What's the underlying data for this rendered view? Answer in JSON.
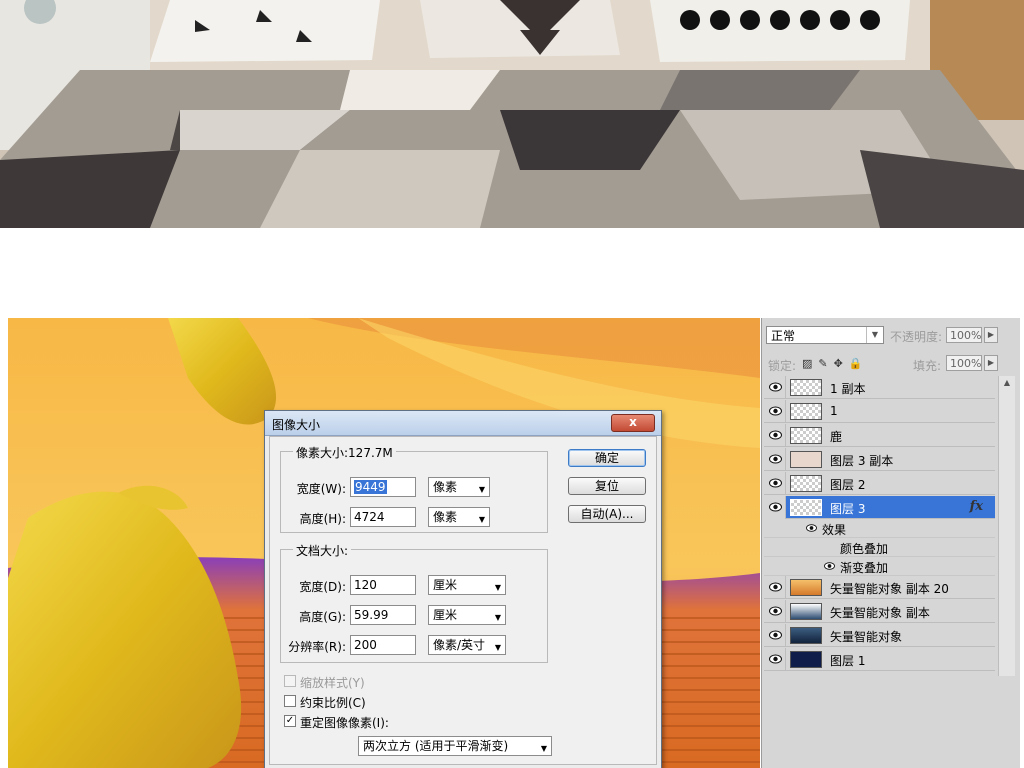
{
  "dialog": {
    "title": "图像大小",
    "close_label": "x",
    "pixel_dims": {
      "legend": "像素大小:127.7M",
      "width_label": "宽度(W):",
      "width_value": "9449",
      "width_unit": "像素",
      "height_label": "高度(H):",
      "height_value": "4724",
      "height_unit": "像素"
    },
    "doc_size": {
      "legend": "文档大小:",
      "width_label": "宽度(D):",
      "width_value": "120",
      "width_unit": "厘米",
      "height_label": "高度(G):",
      "height_value": "59.99",
      "height_unit": "厘米",
      "res_label": "分辨率(R):",
      "res_value": "200",
      "res_unit": "像素/英寸"
    },
    "buttons": {
      "ok": "确定",
      "reset": "复位",
      "auto": "自动(A)..."
    },
    "options": {
      "scale_styles": "缩放样式(Y)",
      "constrain": "约束比例(C)",
      "resample": "重定图像像素(I):",
      "resample_method": "两次立方 (适用于平滑渐变)"
    }
  },
  "layers_panel": {
    "blend_mode": "正常",
    "opacity_label": "不透明度:",
    "opacity_value": "100%",
    "lock_label": "锁定:",
    "fill_label": "填充:",
    "fill_value": "100%",
    "fx_label": "fx",
    "layers": [
      {
        "name": "1 副本"
      },
      {
        "name": "1"
      },
      {
        "name": "鹿"
      },
      {
        "name": "图层 3 副本"
      },
      {
        "name": "图层 2"
      },
      {
        "name": "图层 3",
        "selected": true
      },
      {
        "name": "矢量智能对象 副本 20"
      },
      {
        "name": "矢量智能对象 副本"
      },
      {
        "name": "矢量智能对象"
      },
      {
        "name": "图层 1"
      }
    ],
    "effects": {
      "label": "效果",
      "items": [
        "颜色叠加",
        "渐变叠加"
      ]
    }
  },
  "colors": {
    "selection_blue": "#3875d7",
    "canvas_orange": "#f2a23a",
    "gold": "#e6c22a"
  }
}
